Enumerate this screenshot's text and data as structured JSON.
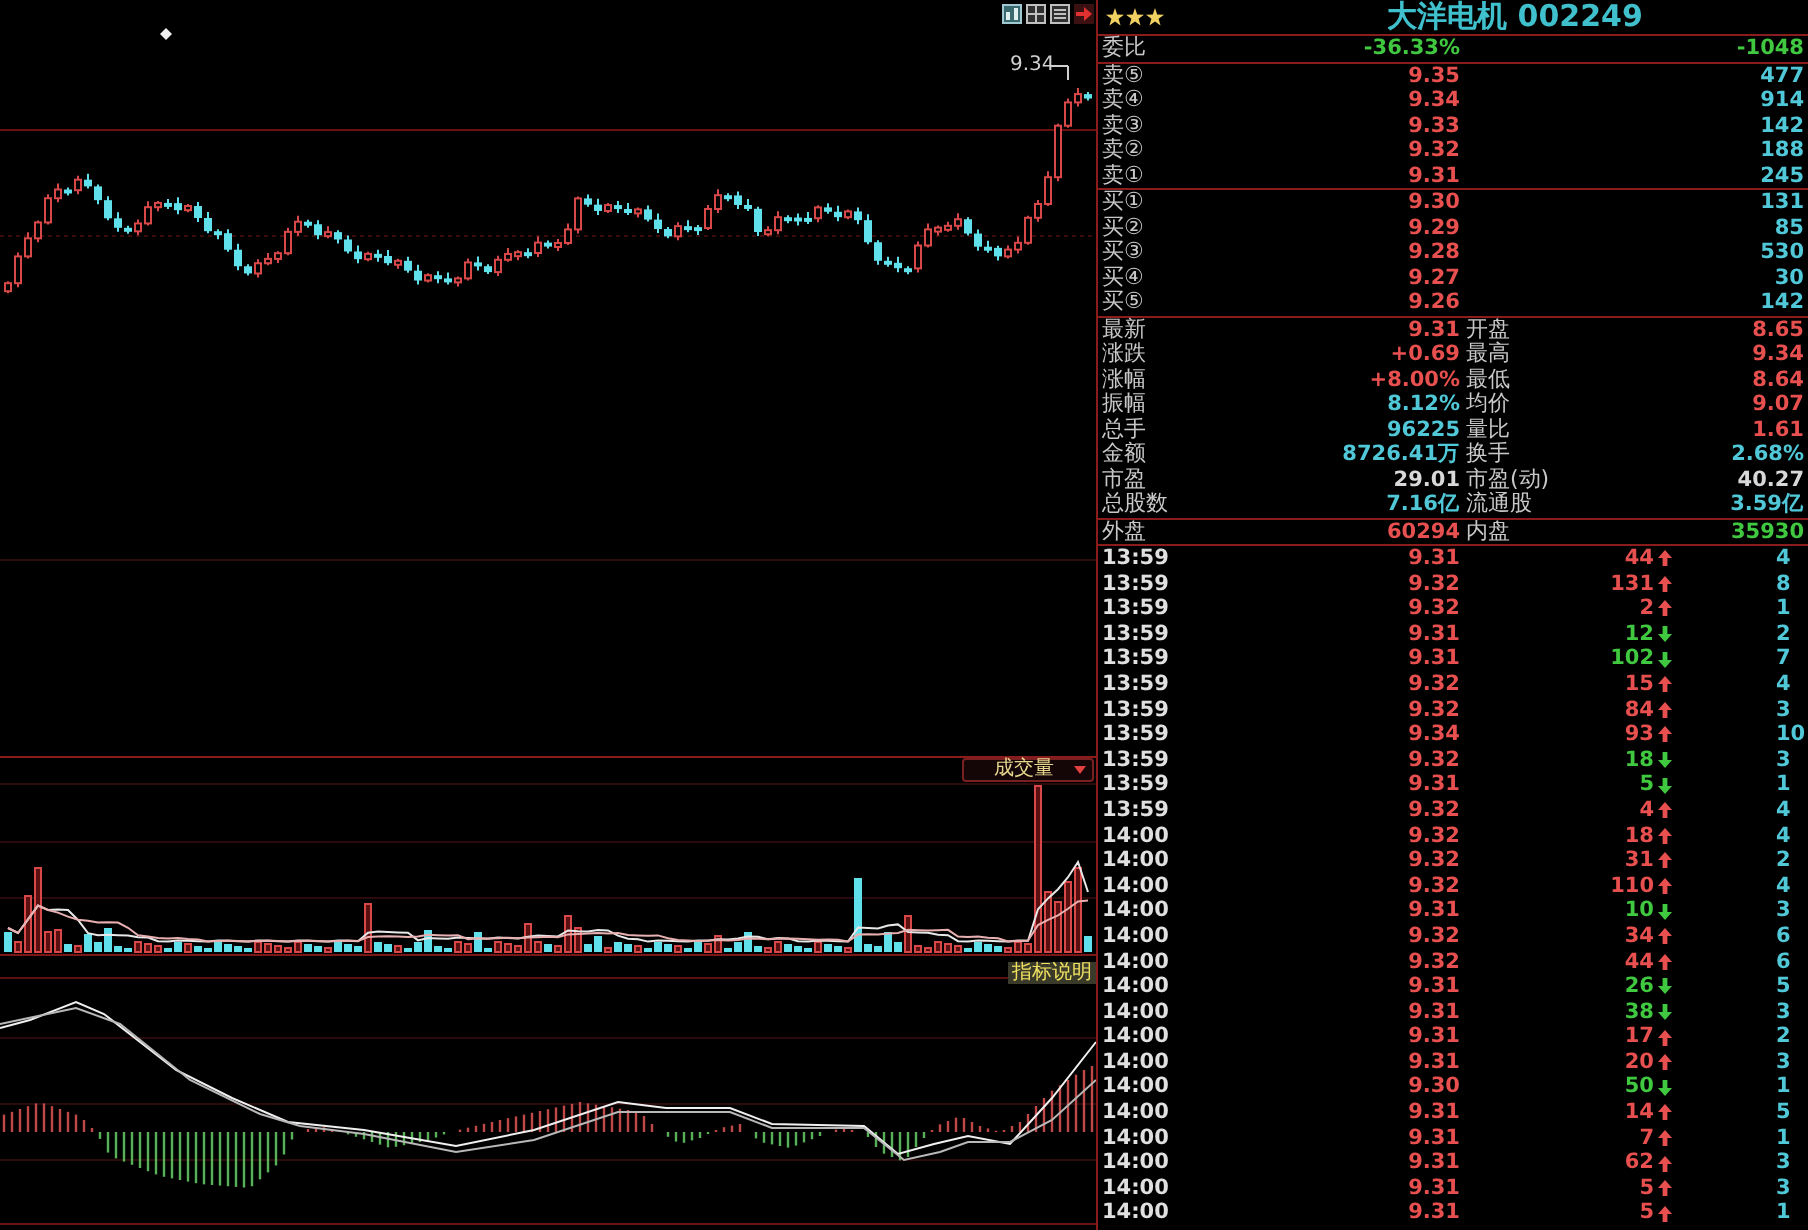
{
  "price_chart": {
    "high_label": "9.34"
  },
  "volume_panel": {
    "indicator": "成交量",
    "help_button": "指标说明"
  },
  "quote": {
    "stars": 3,
    "title": "大洋电机 002249"
  },
  "order_ratio": {
    "label": "委比",
    "percent": "-36.33%",
    "difference": "-1048"
  },
  "asks": [
    {
      "label": "卖⑤",
      "price": "9.35",
      "volume": "477"
    },
    {
      "label": "卖④",
      "price": "9.34",
      "volume": "914"
    },
    {
      "label": "卖③",
      "price": "9.33",
      "volume": "142"
    },
    {
      "label": "卖②",
      "price": "9.32",
      "volume": "188"
    },
    {
      "label": "卖①",
      "price": "9.31",
      "volume": "245"
    }
  ],
  "bids": [
    {
      "label": "买①",
      "price": "9.30",
      "volume": "131"
    },
    {
      "label": "买②",
      "price": "9.29",
      "volume": "85"
    },
    {
      "label": "买③",
      "price": "9.28",
      "volume": "530"
    },
    {
      "label": "买④",
      "price": "9.27",
      "volume": "30"
    },
    {
      "label": "买⑤",
      "price": "9.26",
      "volume": "142"
    }
  ],
  "stats": [
    {
      "label": "最新",
      "value": "9.31",
      "color": "#e85050"
    },
    {
      "label": "开盘",
      "value": "8.65",
      "color": "#e85050"
    },
    {
      "label": "涨跌",
      "value": "+0.69",
      "color": "#e85050"
    },
    {
      "label": "最高",
      "value": "9.34",
      "color": "#e85050"
    },
    {
      "label": "涨幅",
      "value": "+8.00%",
      "color": "#e85050"
    },
    {
      "label": "最低",
      "value": "8.64",
      "color": "#e85050"
    },
    {
      "label": "振幅",
      "value": "8.12%",
      "color": "#50c8d8"
    },
    {
      "label": "均价",
      "value": "9.07",
      "color": "#e85050"
    },
    {
      "label": "总手",
      "value": "96225",
      "color": "#50c8d8"
    },
    {
      "label": "量比",
      "value": "1.61",
      "color": "#e85050"
    },
    {
      "label": "金额",
      "value": "8726.41万",
      "color": "#50c8d8"
    },
    {
      "label": "换手",
      "value": "2.68%",
      "color": "#50c8d8"
    },
    {
      "label": "市盈",
      "value": "29.01",
      "color": "#d8d8d8"
    },
    {
      "label": "市盈(动)",
      "value": "40.27",
      "color": "#d8d8d8"
    },
    {
      "label": "总股数",
      "value": "7.16亿",
      "color": "#50c8d8"
    },
    {
      "label": "流通股",
      "value": "3.59亿",
      "color": "#50c8d8"
    }
  ],
  "volume_split": [
    {
      "label": "外盘",
      "value": "60294",
      "color": "#e85050"
    },
    {
      "label": "内盘",
      "value": "35930",
      "color": "#40c840"
    }
  ],
  "ticks": [
    {
      "time": "13:59",
      "price": "9.31",
      "volume": "44",
      "kind": "up",
      "column_4": "4"
    },
    {
      "time": "13:59",
      "price": "9.32",
      "volume": "131",
      "kind": "up",
      "column_4": "8"
    },
    {
      "time": "13:59",
      "price": "9.32",
      "volume": "2",
      "kind": "up",
      "column_4": "1"
    },
    {
      "time": "13:59",
      "price": "9.31",
      "volume": "12",
      "kind": "down",
      "column_4": "2"
    },
    {
      "time": "13:59",
      "price": "9.31",
      "volume": "102",
      "kind": "down",
      "column_4": "7"
    },
    {
      "time": "13:59",
      "price": "9.32",
      "volume": "15",
      "kind": "up",
      "column_4": "4"
    },
    {
      "time": "13:59",
      "price": "9.32",
      "volume": "84",
      "kind": "up",
      "column_4": "3"
    },
    {
      "time": "13:59",
      "price": "9.34",
      "volume": "93",
      "kind": "up",
      "column_4": "10"
    },
    {
      "time": "13:59",
      "price": "9.32",
      "volume": "18",
      "kind": "down",
      "column_4": "3"
    },
    {
      "time": "13:59",
      "price": "9.31",
      "volume": "5",
      "kind": "down",
      "column_4": "1"
    },
    {
      "time": "13:59",
      "price": "9.32",
      "volume": "4",
      "kind": "up",
      "column_4": "4"
    },
    {
      "time": "14:00",
      "price": "9.32",
      "volume": "18",
      "kind": "up",
      "column_4": "4"
    },
    {
      "time": "14:00",
      "price": "9.32",
      "volume": "31",
      "kind": "up",
      "column_4": "2"
    },
    {
      "time": "14:00",
      "price": "9.32",
      "volume": "110",
      "kind": "up",
      "column_4": "4"
    },
    {
      "time": "14:00",
      "price": "9.31",
      "volume": "10",
      "kind": "down",
      "column_4": "3"
    },
    {
      "time": "14:00",
      "price": "9.32",
      "volume": "34",
      "kind": "up",
      "column_4": "6"
    },
    {
      "time": "14:00",
      "price": "9.32",
      "volume": "44",
      "kind": "up",
      "column_4": "6"
    },
    {
      "time": "14:00",
      "price": "9.31",
      "volume": "26",
      "kind": "down",
      "column_4": "5"
    },
    {
      "time": "14:00",
      "price": "9.31",
      "volume": "38",
      "kind": "down",
      "column_4": "3"
    },
    {
      "time": "14:00",
      "price": "9.31",
      "volume": "17",
      "kind": "up",
      "column_4": "2"
    },
    {
      "time": "14:00",
      "price": "9.31",
      "volume": "20",
      "kind": "up",
      "column_4": "3"
    },
    {
      "time": "14:00",
      "price": "9.30",
      "volume": "50",
      "kind": "down",
      "column_4": "1"
    },
    {
      "time": "14:00",
      "price": "9.31",
      "volume": "14",
      "kind": "up",
      "column_4": "5"
    },
    {
      "time": "14:00",
      "price": "9.31",
      "volume": "7",
      "kind": "up",
      "column_4": "1"
    },
    {
      "time": "14:00",
      "price": "9.31",
      "volume": "62",
      "kind": "up",
      "column_4": "3"
    },
    {
      "time": "14:00",
      "price": "9.31",
      "volume": "5",
      "kind": "up",
      "column_4": "3"
    },
    {
      "time": "14:00",
      "price": "9.31",
      "volume": "5",
      "kind": "up",
      "column_4": "1"
    }
  ]
}
